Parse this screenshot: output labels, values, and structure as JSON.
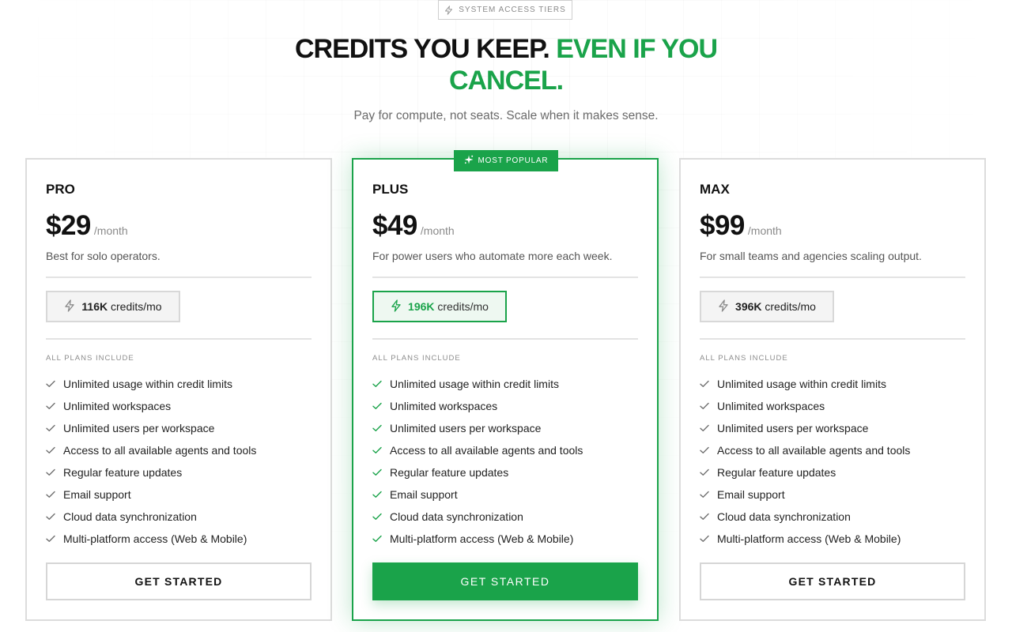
{
  "header": {
    "badge_icon": "bolt-icon",
    "badge_label": "SYSTEM ACCESS TIERS",
    "headline_dark": "CREDITS YOU KEEP.",
    "headline_green_1": "EVEN IF YOU",
    "headline_green_2": "CANCEL.",
    "subheadline": "Pay for compute, not seats. Scale when it makes sense."
  },
  "colors": {
    "accent": "#1aa34a",
    "border": "#dcdcdc",
    "text": "#111111"
  },
  "plans": [
    {
      "name": "PRO",
      "price": "$29",
      "period": "/month",
      "description": "Best for solo operators.",
      "credits_amount": "116K",
      "credits_unit": "credits/mo",
      "includes_label": "ALL PLANS INCLUDE",
      "cta_label": "GET STARTED"
    },
    {
      "name": "PLUS",
      "price": "$49",
      "period": "/month",
      "description": "For power users who automate more each week.",
      "credits_amount": "196K",
      "credits_unit": "credits/mo",
      "includes_label": "ALL PLANS INCLUDE",
      "cta_label": "GET STARTED",
      "badge_label": "MOST POPULAR",
      "badge_icon": "sparkle-icon"
    },
    {
      "name": "MAX",
      "price": "$99",
      "period": "/month",
      "description": "For small teams and agencies scaling output.",
      "credits_amount": "396K",
      "credits_unit": "credits/mo",
      "includes_label": "ALL PLANS INCLUDE",
      "cta_label": "GET STARTED"
    }
  ],
  "features": [
    "Unlimited usage within credit limits",
    "Unlimited workspaces",
    "Unlimited users per workspace",
    "Access to all available agents and tools",
    "Regular feature updates",
    "Email support",
    "Cloud data synchronization",
    "Multi-platform access (Web & Mobile)"
  ]
}
